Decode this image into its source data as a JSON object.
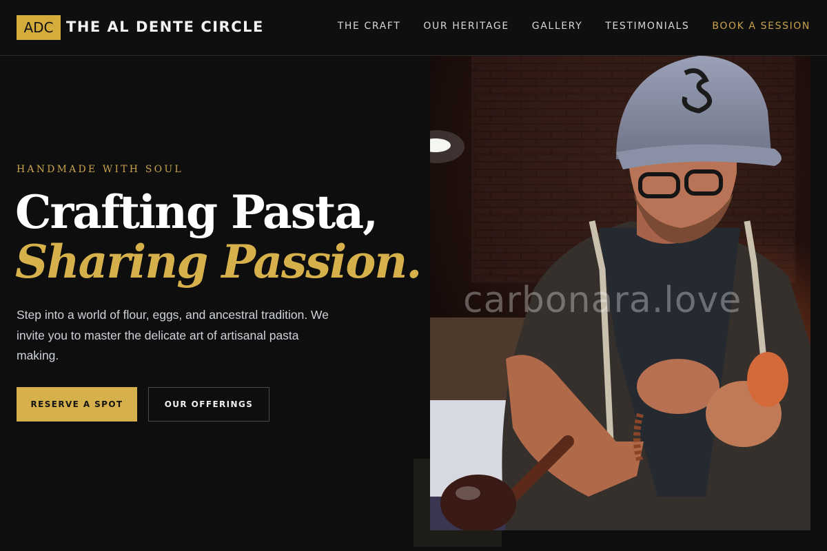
{
  "header": {
    "logo_text": "ADC",
    "brand_name": "THE AL DENTE CIRCLE",
    "nav": [
      {
        "label": "THE CRAFT"
      },
      {
        "label": "OUR HERITAGE"
      },
      {
        "label": "GALLERY"
      },
      {
        "label": "TESTIMONIALS"
      },
      {
        "label": "BOOK A SESSION"
      }
    ]
  },
  "hero": {
    "eyebrow": "HANDMADE WITH SOUL",
    "headline_line1": "Crafting Pasta,",
    "headline_line2": "Sharing Passion.",
    "lead": "Step into a world of flour, eggs, and ancestral tradition. We invite you to master the delicate art of artisanal pasta making.",
    "primary_button": "RESERVE A SPOT",
    "secondary_button": "OUR OFFERINGS",
    "watermark": "carbonara.love"
  },
  "colors": {
    "background": "#0e0e0f",
    "accent_gold": "#d6b04a",
    "nav_cta": "#c9a24a"
  }
}
